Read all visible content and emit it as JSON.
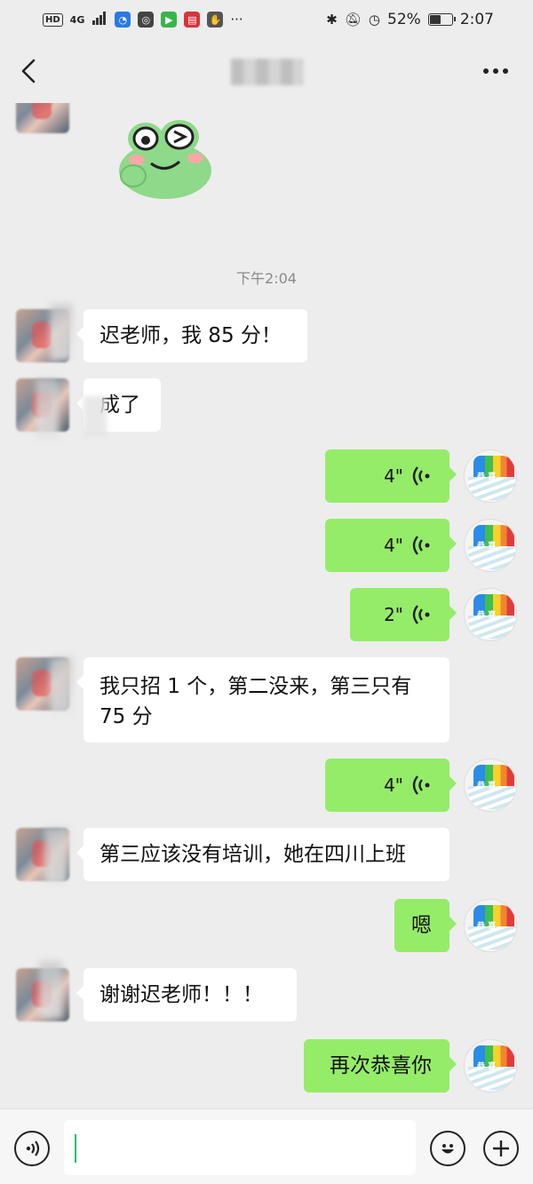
{
  "status_bar": {
    "hd_badge": "HD",
    "network": "4G",
    "battery_percent": "52%",
    "battery_level": 0.52,
    "time": "2:07",
    "icons": [
      "signal-icon",
      "qq-browser-icon",
      "wechat-icon",
      "video-icon",
      "reader-icon",
      "shield-icon",
      "more-dots-icon",
      "bluetooth-icon",
      "mute-icon",
      "speed-icon",
      "battery-icon"
    ]
  },
  "header": {
    "title_blurred": true
  },
  "chat": {
    "timestamp": "下午2:04",
    "messages": [
      {
        "side": "left",
        "type": "text",
        "text": "迟老师，我 85 分！"
      },
      {
        "side": "left",
        "type": "text",
        "text": "成了"
      },
      {
        "side": "right",
        "type": "voice",
        "duration": "4\""
      },
      {
        "side": "right",
        "type": "voice",
        "duration": "4\""
      },
      {
        "side": "right",
        "type": "voice",
        "duration": "2\""
      },
      {
        "side": "left",
        "type": "text",
        "text": "我只招 1 个，第二没来，第三只有\n75 分"
      },
      {
        "side": "right",
        "type": "voice",
        "duration": "4\""
      },
      {
        "side": "left",
        "type": "text",
        "text": "第三应该没有培训，她在四川上班"
      },
      {
        "side": "right",
        "type": "text",
        "text": "嗯"
      },
      {
        "side": "left",
        "type": "text",
        "text": "谢谢迟老师！！！"
      },
      {
        "side": "right",
        "type": "text",
        "text": "再次恭喜你"
      }
    ]
  },
  "input_bar": {
    "value": "",
    "placeholder": ""
  },
  "colors": {
    "background": "#ededed",
    "self_bubble": "#95ec69",
    "other_bubble": "#ffffff",
    "caret": "#07c160"
  }
}
